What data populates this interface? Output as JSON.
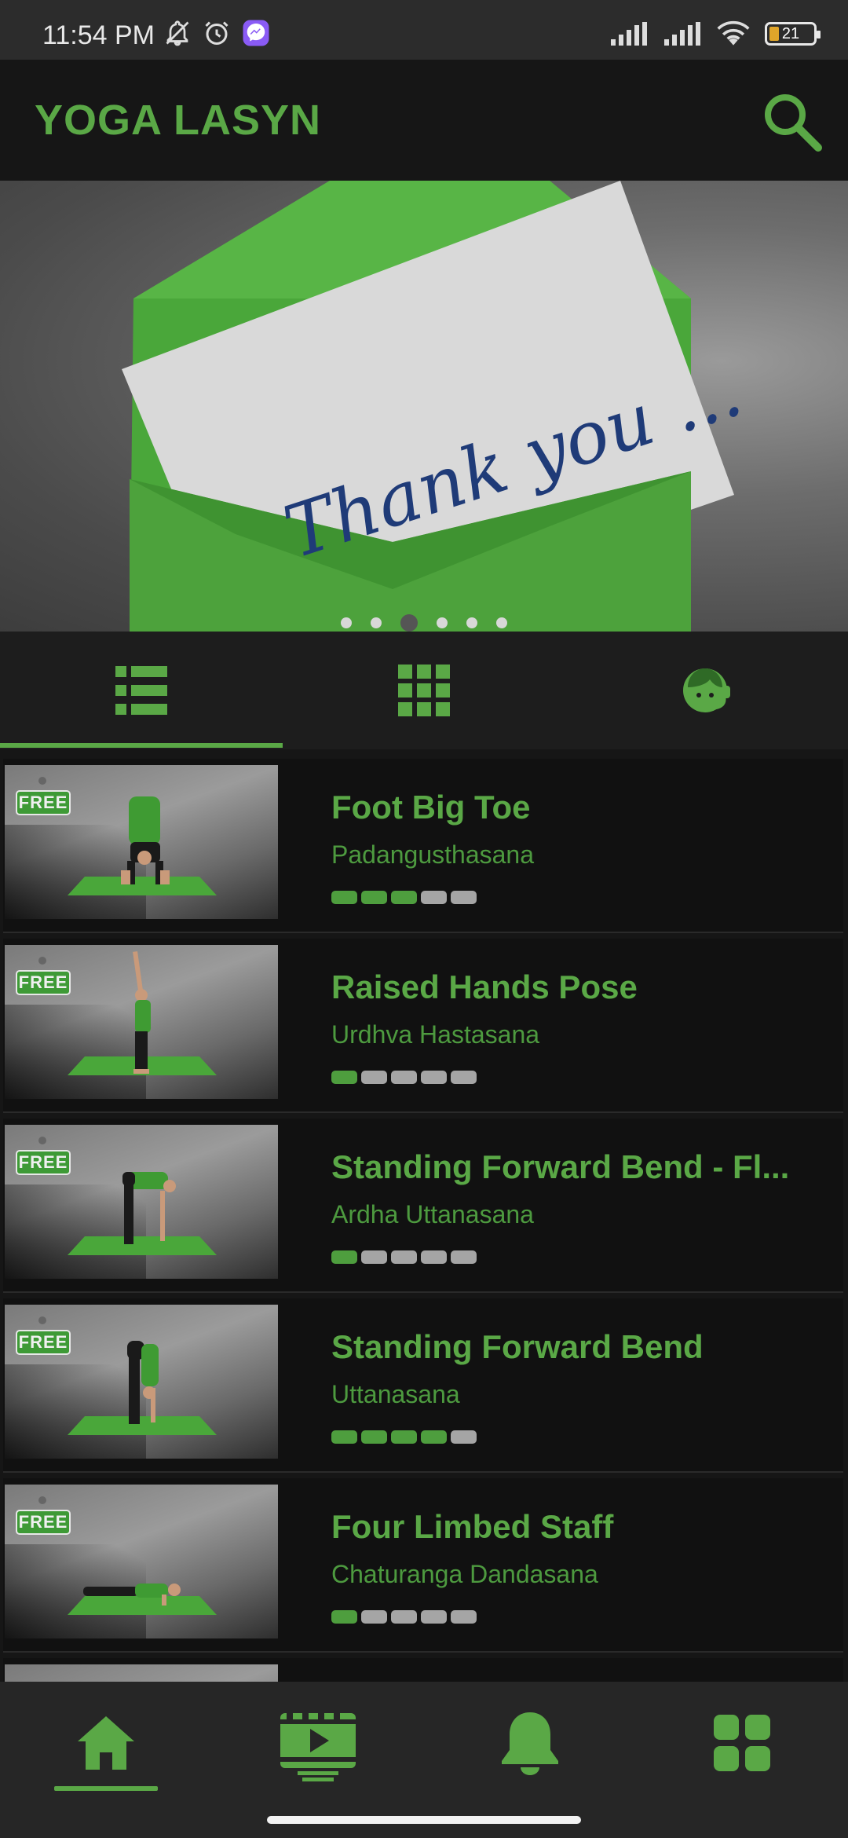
{
  "status_bar": {
    "time": "11:54 PM",
    "battery": "21",
    "left_icons": [
      "bell-off-icon",
      "alarm-icon",
      "messenger-icon"
    ],
    "right_icons": [
      "signal-icon",
      "signal-icon",
      "wifi-icon",
      "battery-icon"
    ]
  },
  "app_bar": {
    "title": "YOGA LASYN",
    "search_icon": "search-icon"
  },
  "banner": {
    "text": "Thank you ...",
    "slide_count": 6,
    "active_slide": 3
  },
  "tabs": [
    {
      "name": "list-view",
      "icon": "list-icon",
      "active": true
    },
    {
      "name": "grid-view",
      "icon": "grid-icon",
      "active": false
    },
    {
      "name": "support",
      "icon": "support-agent-icon",
      "active": false
    }
  ],
  "poses": [
    {
      "title": "Foot Big Toe",
      "subtitle": "Padangusthasana",
      "badge": "FREE",
      "level": 3,
      "level_max": 5
    },
    {
      "title": "Raised Hands Pose",
      "subtitle": "Urdhva Hastasana",
      "badge": "FREE",
      "level": 1,
      "level_max": 5
    },
    {
      "title": "Standing Forward Bend - Fl...",
      "subtitle": "Ardha Uttanasana",
      "badge": "FREE",
      "level": 1,
      "level_max": 5
    },
    {
      "title": "Standing Forward Bend",
      "subtitle": "Uttanasana",
      "badge": "FREE",
      "level": 4,
      "level_max": 5
    },
    {
      "title": "Four Limbed Staff",
      "subtitle": "Chaturanga Dandasana",
      "badge": "FREE",
      "level": 1,
      "level_max": 5
    }
  ],
  "bottom_nav": [
    {
      "name": "home",
      "icon": "home-icon",
      "active": true
    },
    {
      "name": "videos",
      "icon": "video-icon",
      "active": false
    },
    {
      "name": "notifications",
      "icon": "bell-icon",
      "active": false
    },
    {
      "name": "more",
      "icon": "apps-icon",
      "active": false
    }
  ],
  "colors": {
    "accent": "#5aa846",
    "background": "#161616",
    "level_on": "#4e9e3e",
    "level_off": "#a5a5a5"
  }
}
